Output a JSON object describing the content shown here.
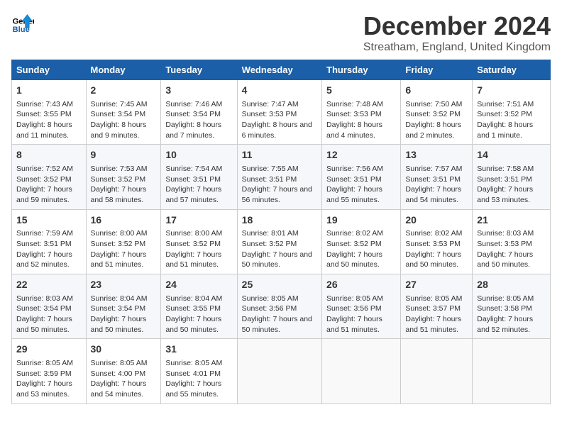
{
  "logo": {
    "line1": "General",
    "line2": "Blue"
  },
  "title": "December 2024",
  "location": "Streatham, England, United Kingdom",
  "days_of_week": [
    "Sunday",
    "Monday",
    "Tuesday",
    "Wednesday",
    "Thursday",
    "Friday",
    "Saturday"
  ],
  "weeks": [
    [
      {
        "day": 1,
        "sunrise": "7:43 AM",
        "sunset": "3:55 PM",
        "daylight": "8 hours and 11 minutes."
      },
      {
        "day": 2,
        "sunrise": "7:45 AM",
        "sunset": "3:54 PM",
        "daylight": "8 hours and 9 minutes."
      },
      {
        "day": 3,
        "sunrise": "7:46 AM",
        "sunset": "3:54 PM",
        "daylight": "8 hours and 7 minutes."
      },
      {
        "day": 4,
        "sunrise": "7:47 AM",
        "sunset": "3:53 PM",
        "daylight": "8 hours and 6 minutes."
      },
      {
        "day": 5,
        "sunrise": "7:48 AM",
        "sunset": "3:53 PM",
        "daylight": "8 hours and 4 minutes."
      },
      {
        "day": 6,
        "sunrise": "7:50 AM",
        "sunset": "3:52 PM",
        "daylight": "8 hours and 2 minutes."
      },
      {
        "day": 7,
        "sunrise": "7:51 AM",
        "sunset": "3:52 PM",
        "daylight": "8 hours and 1 minute."
      }
    ],
    [
      {
        "day": 8,
        "sunrise": "7:52 AM",
        "sunset": "3:52 PM",
        "daylight": "7 hours and 59 minutes."
      },
      {
        "day": 9,
        "sunrise": "7:53 AM",
        "sunset": "3:52 PM",
        "daylight": "7 hours and 58 minutes."
      },
      {
        "day": 10,
        "sunrise": "7:54 AM",
        "sunset": "3:51 PM",
        "daylight": "7 hours and 57 minutes."
      },
      {
        "day": 11,
        "sunrise": "7:55 AM",
        "sunset": "3:51 PM",
        "daylight": "7 hours and 56 minutes."
      },
      {
        "day": 12,
        "sunrise": "7:56 AM",
        "sunset": "3:51 PM",
        "daylight": "7 hours and 55 minutes."
      },
      {
        "day": 13,
        "sunrise": "7:57 AM",
        "sunset": "3:51 PM",
        "daylight": "7 hours and 54 minutes."
      },
      {
        "day": 14,
        "sunrise": "7:58 AM",
        "sunset": "3:51 PM",
        "daylight": "7 hours and 53 minutes."
      }
    ],
    [
      {
        "day": 15,
        "sunrise": "7:59 AM",
        "sunset": "3:51 PM",
        "daylight": "7 hours and 52 minutes."
      },
      {
        "day": 16,
        "sunrise": "8:00 AM",
        "sunset": "3:52 PM",
        "daylight": "7 hours and 51 minutes."
      },
      {
        "day": 17,
        "sunrise": "8:00 AM",
        "sunset": "3:52 PM",
        "daylight": "7 hours and 51 minutes."
      },
      {
        "day": 18,
        "sunrise": "8:01 AM",
        "sunset": "3:52 PM",
        "daylight": "7 hours and 50 minutes."
      },
      {
        "day": 19,
        "sunrise": "8:02 AM",
        "sunset": "3:52 PM",
        "daylight": "7 hours and 50 minutes."
      },
      {
        "day": 20,
        "sunrise": "8:02 AM",
        "sunset": "3:53 PM",
        "daylight": "7 hours and 50 minutes."
      },
      {
        "day": 21,
        "sunrise": "8:03 AM",
        "sunset": "3:53 PM",
        "daylight": "7 hours and 50 minutes."
      }
    ],
    [
      {
        "day": 22,
        "sunrise": "8:03 AM",
        "sunset": "3:54 PM",
        "daylight": "7 hours and 50 minutes."
      },
      {
        "day": 23,
        "sunrise": "8:04 AM",
        "sunset": "3:54 PM",
        "daylight": "7 hours and 50 minutes."
      },
      {
        "day": 24,
        "sunrise": "8:04 AM",
        "sunset": "3:55 PM",
        "daylight": "7 hours and 50 minutes."
      },
      {
        "day": 25,
        "sunrise": "8:05 AM",
        "sunset": "3:56 PM",
        "daylight": "7 hours and 50 minutes."
      },
      {
        "day": 26,
        "sunrise": "8:05 AM",
        "sunset": "3:56 PM",
        "daylight": "7 hours and 51 minutes."
      },
      {
        "day": 27,
        "sunrise": "8:05 AM",
        "sunset": "3:57 PM",
        "daylight": "7 hours and 51 minutes."
      },
      {
        "day": 28,
        "sunrise": "8:05 AM",
        "sunset": "3:58 PM",
        "daylight": "7 hours and 52 minutes."
      }
    ],
    [
      {
        "day": 29,
        "sunrise": "8:05 AM",
        "sunset": "3:59 PM",
        "daylight": "7 hours and 53 minutes."
      },
      {
        "day": 30,
        "sunrise": "8:05 AM",
        "sunset": "4:00 PM",
        "daylight": "7 hours and 54 minutes."
      },
      {
        "day": 31,
        "sunrise": "8:05 AM",
        "sunset": "4:01 PM",
        "daylight": "7 hours and 55 minutes."
      },
      null,
      null,
      null,
      null
    ]
  ]
}
